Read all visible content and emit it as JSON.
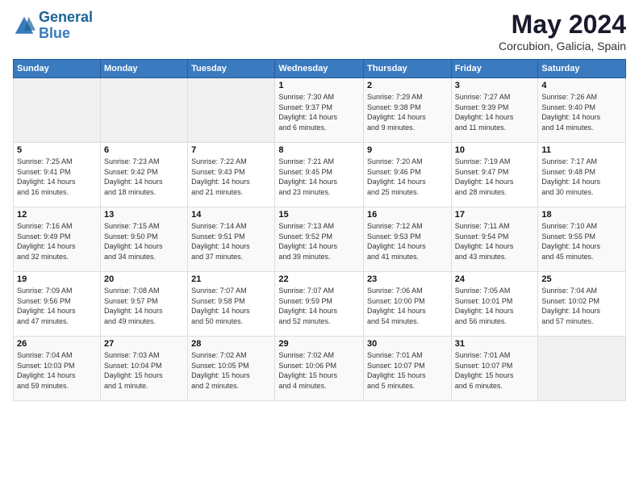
{
  "logo": {
    "line1": "General",
    "line2": "Blue"
  },
  "title": "May 2024",
  "subtitle": "Corcubion, Galicia, Spain",
  "days_header": [
    "Sunday",
    "Monday",
    "Tuesday",
    "Wednesday",
    "Thursday",
    "Friday",
    "Saturday"
  ],
  "weeks": [
    [
      {
        "day": "",
        "info": ""
      },
      {
        "day": "",
        "info": ""
      },
      {
        "day": "",
        "info": ""
      },
      {
        "day": "1",
        "info": "Sunrise: 7:30 AM\nSunset: 9:37 PM\nDaylight: 14 hours\nand 6 minutes."
      },
      {
        "day": "2",
        "info": "Sunrise: 7:29 AM\nSunset: 9:38 PM\nDaylight: 14 hours\nand 9 minutes."
      },
      {
        "day": "3",
        "info": "Sunrise: 7:27 AM\nSunset: 9:39 PM\nDaylight: 14 hours\nand 11 minutes."
      },
      {
        "day": "4",
        "info": "Sunrise: 7:26 AM\nSunset: 9:40 PM\nDaylight: 14 hours\nand 14 minutes."
      }
    ],
    [
      {
        "day": "5",
        "info": "Sunrise: 7:25 AM\nSunset: 9:41 PM\nDaylight: 14 hours\nand 16 minutes."
      },
      {
        "day": "6",
        "info": "Sunrise: 7:23 AM\nSunset: 9:42 PM\nDaylight: 14 hours\nand 18 minutes."
      },
      {
        "day": "7",
        "info": "Sunrise: 7:22 AM\nSunset: 9:43 PM\nDaylight: 14 hours\nand 21 minutes."
      },
      {
        "day": "8",
        "info": "Sunrise: 7:21 AM\nSunset: 9:45 PM\nDaylight: 14 hours\nand 23 minutes."
      },
      {
        "day": "9",
        "info": "Sunrise: 7:20 AM\nSunset: 9:46 PM\nDaylight: 14 hours\nand 25 minutes."
      },
      {
        "day": "10",
        "info": "Sunrise: 7:19 AM\nSunset: 9:47 PM\nDaylight: 14 hours\nand 28 minutes."
      },
      {
        "day": "11",
        "info": "Sunrise: 7:17 AM\nSunset: 9:48 PM\nDaylight: 14 hours\nand 30 minutes."
      }
    ],
    [
      {
        "day": "12",
        "info": "Sunrise: 7:16 AM\nSunset: 9:49 PM\nDaylight: 14 hours\nand 32 minutes."
      },
      {
        "day": "13",
        "info": "Sunrise: 7:15 AM\nSunset: 9:50 PM\nDaylight: 14 hours\nand 34 minutes."
      },
      {
        "day": "14",
        "info": "Sunrise: 7:14 AM\nSunset: 9:51 PM\nDaylight: 14 hours\nand 37 minutes."
      },
      {
        "day": "15",
        "info": "Sunrise: 7:13 AM\nSunset: 9:52 PM\nDaylight: 14 hours\nand 39 minutes."
      },
      {
        "day": "16",
        "info": "Sunrise: 7:12 AM\nSunset: 9:53 PM\nDaylight: 14 hours\nand 41 minutes."
      },
      {
        "day": "17",
        "info": "Sunrise: 7:11 AM\nSunset: 9:54 PM\nDaylight: 14 hours\nand 43 minutes."
      },
      {
        "day": "18",
        "info": "Sunrise: 7:10 AM\nSunset: 9:55 PM\nDaylight: 14 hours\nand 45 minutes."
      }
    ],
    [
      {
        "day": "19",
        "info": "Sunrise: 7:09 AM\nSunset: 9:56 PM\nDaylight: 14 hours\nand 47 minutes."
      },
      {
        "day": "20",
        "info": "Sunrise: 7:08 AM\nSunset: 9:57 PM\nDaylight: 14 hours\nand 49 minutes."
      },
      {
        "day": "21",
        "info": "Sunrise: 7:07 AM\nSunset: 9:58 PM\nDaylight: 14 hours\nand 50 minutes."
      },
      {
        "day": "22",
        "info": "Sunrise: 7:07 AM\nSunset: 9:59 PM\nDaylight: 14 hours\nand 52 minutes."
      },
      {
        "day": "23",
        "info": "Sunrise: 7:06 AM\nSunset: 10:00 PM\nDaylight: 14 hours\nand 54 minutes."
      },
      {
        "day": "24",
        "info": "Sunrise: 7:05 AM\nSunset: 10:01 PM\nDaylight: 14 hours\nand 56 minutes."
      },
      {
        "day": "25",
        "info": "Sunrise: 7:04 AM\nSunset: 10:02 PM\nDaylight: 14 hours\nand 57 minutes."
      }
    ],
    [
      {
        "day": "26",
        "info": "Sunrise: 7:04 AM\nSunset: 10:03 PM\nDaylight: 14 hours\nand 59 minutes."
      },
      {
        "day": "27",
        "info": "Sunrise: 7:03 AM\nSunset: 10:04 PM\nDaylight: 15 hours\nand 1 minute."
      },
      {
        "day": "28",
        "info": "Sunrise: 7:02 AM\nSunset: 10:05 PM\nDaylight: 15 hours\nand 2 minutes."
      },
      {
        "day": "29",
        "info": "Sunrise: 7:02 AM\nSunset: 10:06 PM\nDaylight: 15 hours\nand 4 minutes."
      },
      {
        "day": "30",
        "info": "Sunrise: 7:01 AM\nSunset: 10:07 PM\nDaylight: 15 hours\nand 5 minutes."
      },
      {
        "day": "31",
        "info": "Sunrise: 7:01 AM\nSunset: 10:07 PM\nDaylight: 15 hours\nand 6 minutes."
      },
      {
        "day": "",
        "info": ""
      }
    ]
  ]
}
